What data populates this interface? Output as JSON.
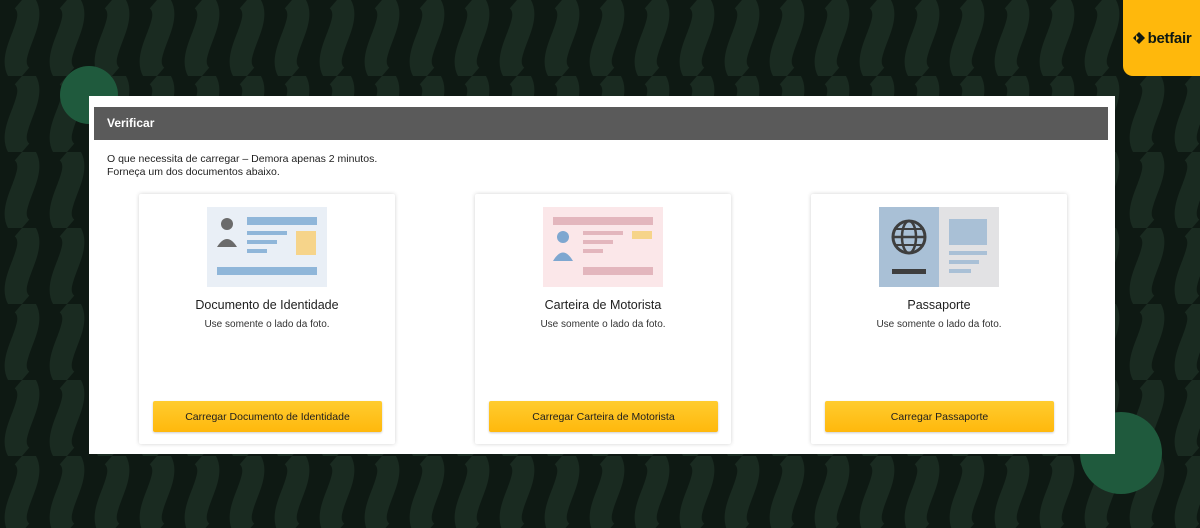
{
  "brand": {
    "name": "betfair",
    "accent": "#ffb80c"
  },
  "panel": {
    "title": "Verificar",
    "intro_line1": "O que necessita de carregar – Demora apenas 2 minutos.",
    "intro_line2": "Forneça um dos documentos abaixo."
  },
  "documents": [
    {
      "title": "Documento de Identidade",
      "subtitle": "Use somente o lado da foto.",
      "button": "Carregar Documento de Identidade",
      "icon": "id-card-icon"
    },
    {
      "title": "Carteira de Motorista",
      "subtitle": "Use somente o lado da foto.",
      "button": "Carregar Carteira de Motorista",
      "icon": "driver-license-icon"
    },
    {
      "title": "Passaporte",
      "subtitle": "Use somente o lado da foto.",
      "button": "Carregar Passaporte",
      "icon": "passport-icon"
    }
  ],
  "colors": {
    "background": "#0e1913",
    "decor_circle": "#1f5a3d",
    "header": "#5a5a5a",
    "button": "#ffb80c"
  }
}
